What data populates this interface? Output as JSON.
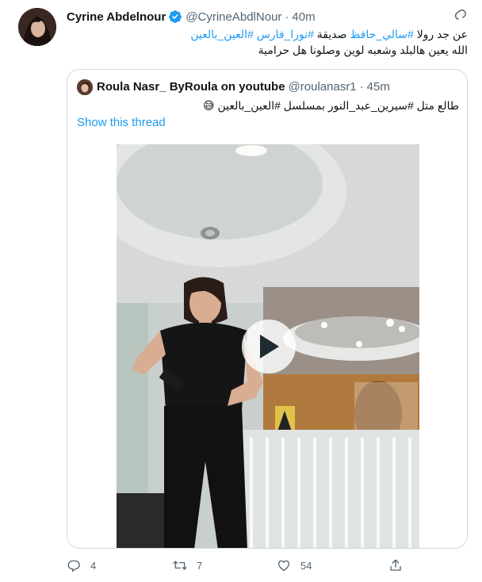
{
  "author": {
    "name": "Cyrine Abdelnour",
    "handle": "@CyrineAbdlNour",
    "separator": "·",
    "time": "40m",
    "avatar_icon": "profile-photo"
  },
  "tweet": {
    "line1_prefix": "عن جد رولا",
    "hashtag1": "#سالي_حافظ",
    "line1_mid": "صديقة",
    "hashtag2": "#نورا_فارس",
    "hashtag3": "#العين_بالعين",
    "line2": "الله يعين هالبلد وشعبه لوين وصلونا هل حرامية"
  },
  "quoted": {
    "name": "Roula Nasr_ ByRoula on youtube",
    "handle": "@roulanasr1",
    "separator": "·",
    "time": "45m",
    "text": "طالع  متل #سيرين_عبد_النور بمسلسل #العين_بالعين 😅",
    "show_thread": "Show this thread",
    "media": "video",
    "play_icon": "play-icon"
  },
  "actions": {
    "reply_count": "4",
    "retweet_count": "7",
    "like_count": "54"
  },
  "colors": {
    "link": "#1d9bf0",
    "secondary": "#536471",
    "border": "#cfd9de",
    "verified": "#1d9bf0"
  }
}
